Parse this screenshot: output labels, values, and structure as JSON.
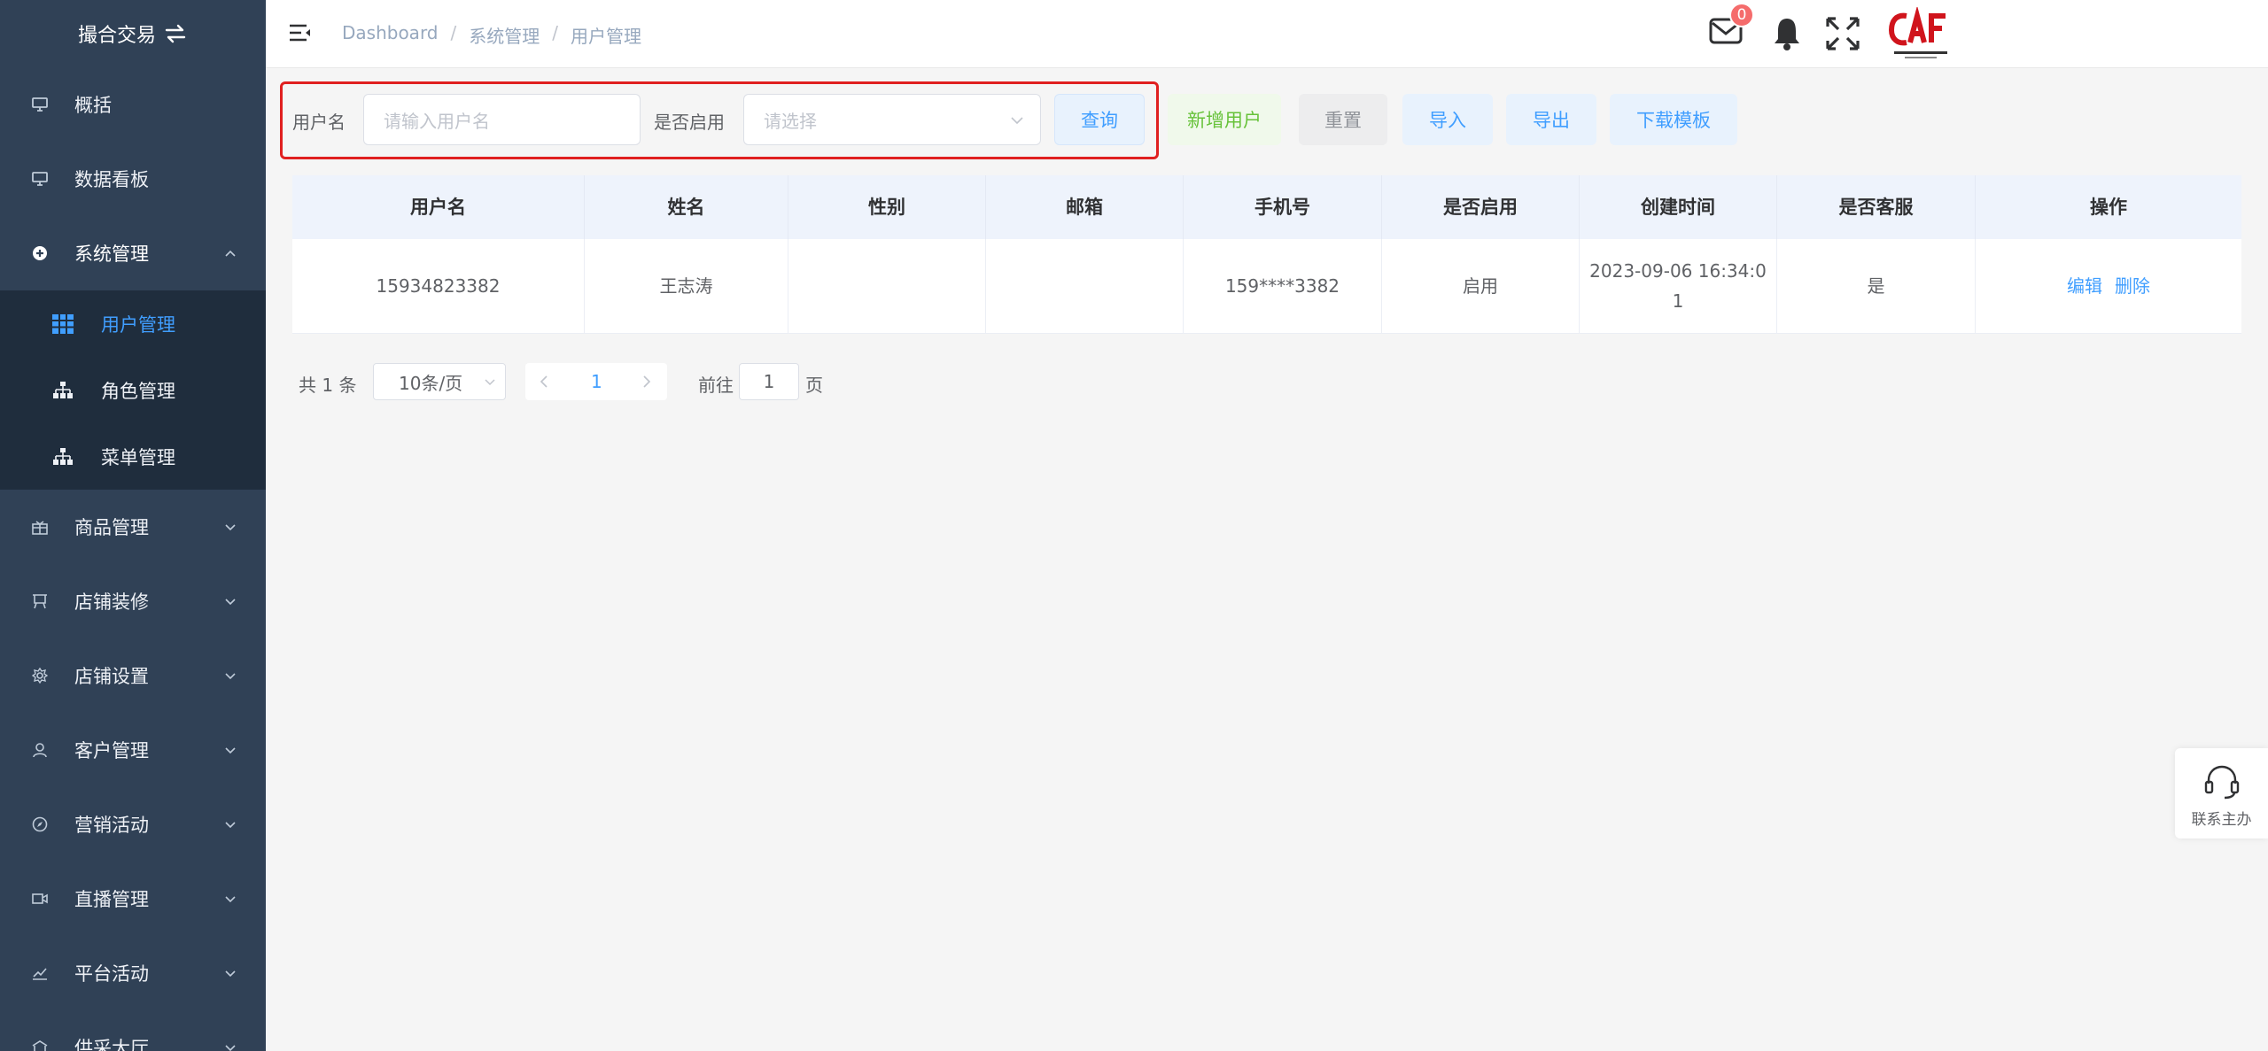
{
  "app": {
    "title": "撮合交易"
  },
  "sidebar": {
    "items": [
      {
        "label": "概括",
        "icon": "monitor-icon"
      },
      {
        "label": "数据看板",
        "icon": "monitor-icon"
      },
      {
        "label": "系统管理",
        "icon": "gear-icon",
        "expanded": true
      },
      {
        "label": "商品管理",
        "icon": "gift-icon"
      },
      {
        "label": "店铺装修",
        "icon": "easel-icon"
      },
      {
        "label": "店铺设置",
        "icon": "cog-icon"
      },
      {
        "label": "客户管理",
        "icon": "user-icon"
      },
      {
        "label": "营销活动",
        "icon": "compass-icon"
      },
      {
        "label": "直播管理",
        "icon": "video-icon"
      },
      {
        "label": "平台活动",
        "icon": "chart-icon"
      },
      {
        "label": "供采大厅",
        "icon": "hall-icon"
      }
    ],
    "submenu": [
      {
        "label": "用户管理",
        "icon": "table-icon",
        "active": true
      },
      {
        "label": "角色管理",
        "icon": "tree-icon"
      },
      {
        "label": "菜单管理",
        "icon": "tree-icon"
      }
    ]
  },
  "header": {
    "breadcrumb": [
      "Dashboard",
      "系统管理",
      "用户管理"
    ],
    "breadcrumb_sep": "/",
    "mail_badge": "0"
  },
  "search": {
    "username_label": "用户名",
    "username_placeholder": "请输入用户名",
    "enabled_label": "是否启用",
    "enabled_placeholder": "请选择",
    "query_button": "查询"
  },
  "toolbar": {
    "add_user": "新增用户",
    "reset": "重置",
    "import": "导入",
    "export": "导出",
    "download_template": "下载模板"
  },
  "table": {
    "columns": [
      "用户名",
      "姓名",
      "性别",
      "邮箱",
      "手机号",
      "是否启用",
      "创建时间",
      "是否客服",
      "操作"
    ],
    "rows": [
      {
        "username": "15934823382",
        "name": "王志涛",
        "gender": "",
        "email": "",
        "phone": "159****3382",
        "enabled": "启用",
        "created_line1": "2023-09-06 16:34:0",
        "created_line2": "1",
        "is_service": "是",
        "edit": "编辑",
        "delete": "删除"
      }
    ]
  },
  "pagination": {
    "total": "共 1 条",
    "page_size": "10条/页",
    "current_page": "1",
    "goto_label": "前往",
    "goto_value": "1",
    "page_suffix": "页"
  },
  "support": {
    "label": "联系主办"
  },
  "colors": {
    "sidebar_bg": "#304156",
    "submenu_bg": "#1f2d3d",
    "accent": "#409eff",
    "success": "#67c23a",
    "danger": "#f56c6c",
    "highlight_box": "#e02020"
  }
}
